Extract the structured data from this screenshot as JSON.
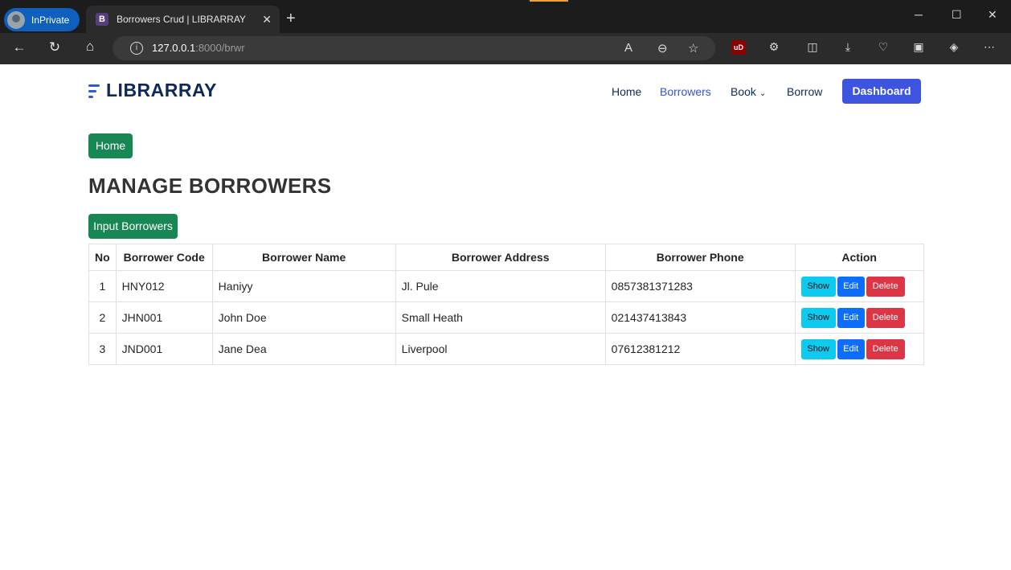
{
  "browser": {
    "profile_label": "InPrivate",
    "tab_favicon": "B",
    "tab_title": "Borrowers Crud | LIBRARRAY",
    "url_host": "127.0.0.1",
    "url_rest": ":8000/brwr",
    "icons": [
      "back-icon",
      "refresh-icon",
      "home-icon",
      "info-icon",
      "read-aloud-icon",
      "zoom-icon",
      "favorite-icon",
      "ublock-icon",
      "extensions-icon",
      "split-screen-icon",
      "downloads-icon",
      "performance-icon",
      "screenshot-icon",
      "copilot-icon",
      "more-icon"
    ],
    "ublock_label": "uD"
  },
  "site": {
    "brand": "LIBRARRAY",
    "menu": [
      "Home",
      "Borrowers",
      "Book",
      "Borrow"
    ],
    "active_menu": "Borrowers",
    "dashboard_label": "Dashboard",
    "accent_color": "#3d54e0"
  },
  "page": {
    "breadcrumb_label": "Home",
    "title": "MANAGE BORROWERS",
    "input_button_label": "Input Borrowers"
  },
  "table": {
    "headers": [
      "No",
      "Borrower Code",
      "Borrower Name",
      "Borrower Address",
      "Borrower Phone",
      "Action"
    ],
    "rows": [
      {
        "no": "1",
        "code": "HNY012",
        "name": "Haniyy",
        "address": "Jl. Pule",
        "phone": "0857381371283"
      },
      {
        "no": "2",
        "code": "JHN001",
        "name": "John Doe",
        "address": "Small Heath",
        "phone": "021437413843"
      },
      {
        "no": "3",
        "code": "JND001",
        "name": "Jane Dea",
        "address": "Liverpool",
        "phone": "07612381212"
      }
    ],
    "actions": {
      "show": "Show",
      "edit": "Edit",
      "delete": "Delete"
    }
  }
}
